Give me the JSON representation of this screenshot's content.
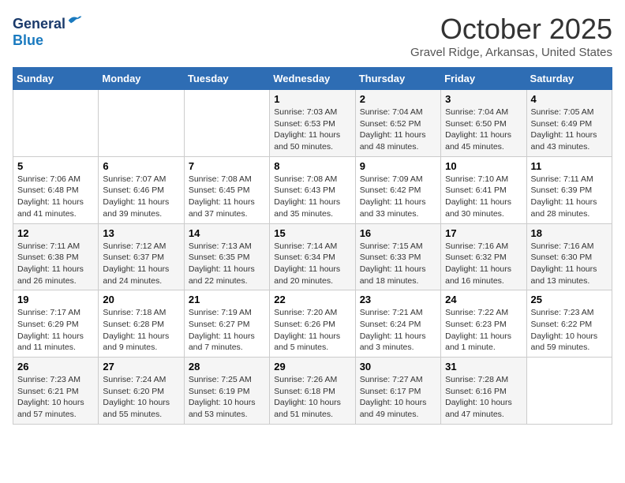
{
  "header": {
    "logo_line1": "General",
    "logo_line2": "Blue",
    "month": "October 2025",
    "location": "Gravel Ridge, Arkansas, United States"
  },
  "days_of_week": [
    "Sunday",
    "Monday",
    "Tuesday",
    "Wednesday",
    "Thursday",
    "Friday",
    "Saturday"
  ],
  "weeks": [
    [
      {
        "num": "",
        "info": ""
      },
      {
        "num": "",
        "info": ""
      },
      {
        "num": "",
        "info": ""
      },
      {
        "num": "1",
        "info": "Sunrise: 7:03 AM\nSunset: 6:53 PM\nDaylight: 11 hours\nand 50 minutes."
      },
      {
        "num": "2",
        "info": "Sunrise: 7:04 AM\nSunset: 6:52 PM\nDaylight: 11 hours\nand 48 minutes."
      },
      {
        "num": "3",
        "info": "Sunrise: 7:04 AM\nSunset: 6:50 PM\nDaylight: 11 hours\nand 45 minutes."
      },
      {
        "num": "4",
        "info": "Sunrise: 7:05 AM\nSunset: 6:49 PM\nDaylight: 11 hours\nand 43 minutes."
      }
    ],
    [
      {
        "num": "5",
        "info": "Sunrise: 7:06 AM\nSunset: 6:48 PM\nDaylight: 11 hours\nand 41 minutes."
      },
      {
        "num": "6",
        "info": "Sunrise: 7:07 AM\nSunset: 6:46 PM\nDaylight: 11 hours\nand 39 minutes."
      },
      {
        "num": "7",
        "info": "Sunrise: 7:08 AM\nSunset: 6:45 PM\nDaylight: 11 hours\nand 37 minutes."
      },
      {
        "num": "8",
        "info": "Sunrise: 7:08 AM\nSunset: 6:43 PM\nDaylight: 11 hours\nand 35 minutes."
      },
      {
        "num": "9",
        "info": "Sunrise: 7:09 AM\nSunset: 6:42 PM\nDaylight: 11 hours\nand 33 minutes."
      },
      {
        "num": "10",
        "info": "Sunrise: 7:10 AM\nSunset: 6:41 PM\nDaylight: 11 hours\nand 30 minutes."
      },
      {
        "num": "11",
        "info": "Sunrise: 7:11 AM\nSunset: 6:39 PM\nDaylight: 11 hours\nand 28 minutes."
      }
    ],
    [
      {
        "num": "12",
        "info": "Sunrise: 7:11 AM\nSunset: 6:38 PM\nDaylight: 11 hours\nand 26 minutes."
      },
      {
        "num": "13",
        "info": "Sunrise: 7:12 AM\nSunset: 6:37 PM\nDaylight: 11 hours\nand 24 minutes."
      },
      {
        "num": "14",
        "info": "Sunrise: 7:13 AM\nSunset: 6:35 PM\nDaylight: 11 hours\nand 22 minutes."
      },
      {
        "num": "15",
        "info": "Sunrise: 7:14 AM\nSunset: 6:34 PM\nDaylight: 11 hours\nand 20 minutes."
      },
      {
        "num": "16",
        "info": "Sunrise: 7:15 AM\nSunset: 6:33 PM\nDaylight: 11 hours\nand 18 minutes."
      },
      {
        "num": "17",
        "info": "Sunrise: 7:16 AM\nSunset: 6:32 PM\nDaylight: 11 hours\nand 16 minutes."
      },
      {
        "num": "18",
        "info": "Sunrise: 7:16 AM\nSunset: 6:30 PM\nDaylight: 11 hours\nand 13 minutes."
      }
    ],
    [
      {
        "num": "19",
        "info": "Sunrise: 7:17 AM\nSunset: 6:29 PM\nDaylight: 11 hours\nand 11 minutes."
      },
      {
        "num": "20",
        "info": "Sunrise: 7:18 AM\nSunset: 6:28 PM\nDaylight: 11 hours\nand 9 minutes."
      },
      {
        "num": "21",
        "info": "Sunrise: 7:19 AM\nSunset: 6:27 PM\nDaylight: 11 hours\nand 7 minutes."
      },
      {
        "num": "22",
        "info": "Sunrise: 7:20 AM\nSunset: 6:26 PM\nDaylight: 11 hours\nand 5 minutes."
      },
      {
        "num": "23",
        "info": "Sunrise: 7:21 AM\nSunset: 6:24 PM\nDaylight: 11 hours\nand 3 minutes."
      },
      {
        "num": "24",
        "info": "Sunrise: 7:22 AM\nSunset: 6:23 PM\nDaylight: 11 hours\nand 1 minute."
      },
      {
        "num": "25",
        "info": "Sunrise: 7:23 AM\nSunset: 6:22 PM\nDaylight: 10 hours\nand 59 minutes."
      }
    ],
    [
      {
        "num": "26",
        "info": "Sunrise: 7:23 AM\nSunset: 6:21 PM\nDaylight: 10 hours\nand 57 minutes."
      },
      {
        "num": "27",
        "info": "Sunrise: 7:24 AM\nSunset: 6:20 PM\nDaylight: 10 hours\nand 55 minutes."
      },
      {
        "num": "28",
        "info": "Sunrise: 7:25 AM\nSunset: 6:19 PM\nDaylight: 10 hours\nand 53 minutes."
      },
      {
        "num": "29",
        "info": "Sunrise: 7:26 AM\nSunset: 6:18 PM\nDaylight: 10 hours\nand 51 minutes."
      },
      {
        "num": "30",
        "info": "Sunrise: 7:27 AM\nSunset: 6:17 PM\nDaylight: 10 hours\nand 49 minutes."
      },
      {
        "num": "31",
        "info": "Sunrise: 7:28 AM\nSunset: 6:16 PM\nDaylight: 10 hours\nand 47 minutes."
      },
      {
        "num": "",
        "info": ""
      }
    ]
  ]
}
